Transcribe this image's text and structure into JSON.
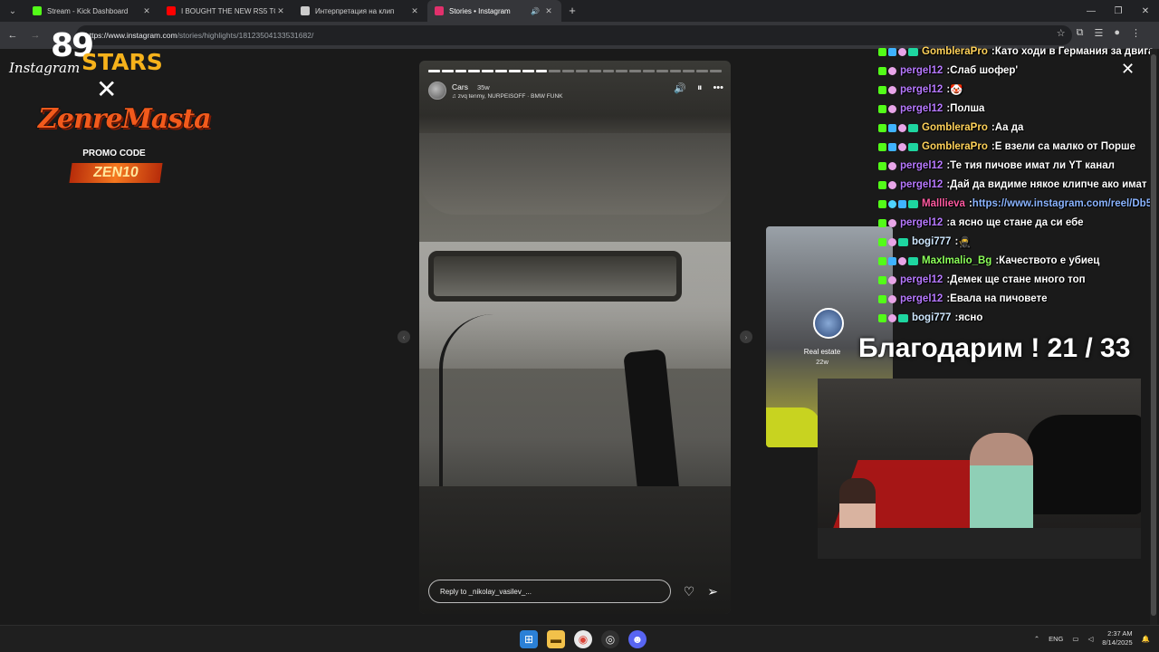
{
  "browser": {
    "tabs": [
      {
        "title": "Stream - Kick Dashboard",
        "fav_color": "#53fc18",
        "active": false
      },
      {
        "title": "I BOUGHT THE NEW RS5 TO RE",
        "fav_color": "#ff0000",
        "active": false
      },
      {
        "title": "Интерпретация на клип",
        "fav_color": "#cccccc",
        "active": false
      },
      {
        "title": "Stories • Instagram",
        "fav_color": "#e1306c",
        "active": true
      }
    ],
    "new_tab": "+",
    "url_host": "https://www.instagram.com",
    "url_path": "/stories/highlights/18123504133531682/"
  },
  "instagram": {
    "logo": "Instagram",
    "story": {
      "user": "Cars",
      "age": "35w",
      "music": "zvq tenmy, NURPEISOFF · BMW FUNK",
      "reply_placeholder": "Reply to _nikolay_vasilev_...",
      "progress_total": 22,
      "progress_done": 9
    },
    "next_story": {
      "user": "Real estate",
      "age": "22w"
    }
  },
  "overlay": {
    "sponsor": {
      "number": "89",
      "brand": "STARS",
      "cross": "✕",
      "partner": "ZenreMasta",
      "promo_label": "PROMO CODE",
      "promo_code": "ZEN10"
    },
    "goal": "Благодарим ! 21 / 33"
  },
  "chat": {
    "messages": [
      {
        "user": "GomblerаPro",
        "color": "#ffd25a",
        "text": "Като ходи в Германия за двига",
        "badges": [
          "kick",
          "gift",
          "sub",
          "cash"
        ]
      },
      {
        "user": "pergel12",
        "color": "#b779ff",
        "text": "Слаб шофер'",
        "badges": [
          "kick",
          "sub"
        ]
      },
      {
        "user": "pergel12",
        "color": "#b779ff",
        "text": "🤡",
        "badges": [
          "kick",
          "sub"
        ]
      },
      {
        "user": "pergel12",
        "color": "#b779ff",
        "text": "Полша",
        "badges": [
          "kick",
          "sub"
        ]
      },
      {
        "user": "GomblerаPro",
        "color": "#ffd25a",
        "text": "Аа да",
        "badges": [
          "kick",
          "gift",
          "sub",
          "cash"
        ]
      },
      {
        "user": "GomblerаPro",
        "color": "#ffd25a",
        "text": "Е взели са малко от Порше",
        "badges": [
          "kick",
          "gift",
          "sub",
          "cash"
        ]
      },
      {
        "user": "pergel12",
        "color": "#b779ff",
        "text": "Те тия пичове имат ли YT канал",
        "badges": [
          "kick",
          "sub"
        ]
      },
      {
        "user": "pergel12",
        "color": "#b779ff",
        "text": "Дай да видиме някое клипче ако имат",
        "badges": [
          "kick",
          "sub"
        ]
      },
      {
        "user": "Malllieva",
        "color": "#ff5aa0",
        "text": "https://www.instagram.com/reel/Db5",
        "badges": [
          "kick",
          "vip",
          "gift",
          "cash"
        ],
        "link": true
      },
      {
        "user": "pergel12",
        "color": "#b779ff",
        "text": "а ясно ще стане да си ебе",
        "badges": [
          "kick",
          "sub"
        ]
      },
      {
        "user": "bogi777",
        "color": "#cfe8ff",
        "text": "🥷",
        "badges": [
          "kick",
          "sub",
          "cash"
        ]
      },
      {
        "user": "MaxImalio_Bg",
        "color": "#8cff5a",
        "text": "Качеството е убиец",
        "badges": [
          "kick",
          "gift",
          "sub",
          "cash"
        ]
      },
      {
        "user": "pergel12",
        "color": "#b779ff",
        "text": "Демек ще стане много топ",
        "badges": [
          "kick",
          "sub"
        ]
      },
      {
        "user": "pergel12",
        "color": "#b779ff",
        "text": "Евала на пичовете",
        "badges": [
          "kick",
          "sub"
        ]
      },
      {
        "user": "bogi777",
        "color": "#cfe8ff",
        "text": "ясно",
        "badges": [
          "kick",
          "sub",
          "cash"
        ]
      }
    ]
  },
  "taskbar": {
    "language": "ENG",
    "time": "2:37 AM",
    "date": "8/14/2025"
  }
}
